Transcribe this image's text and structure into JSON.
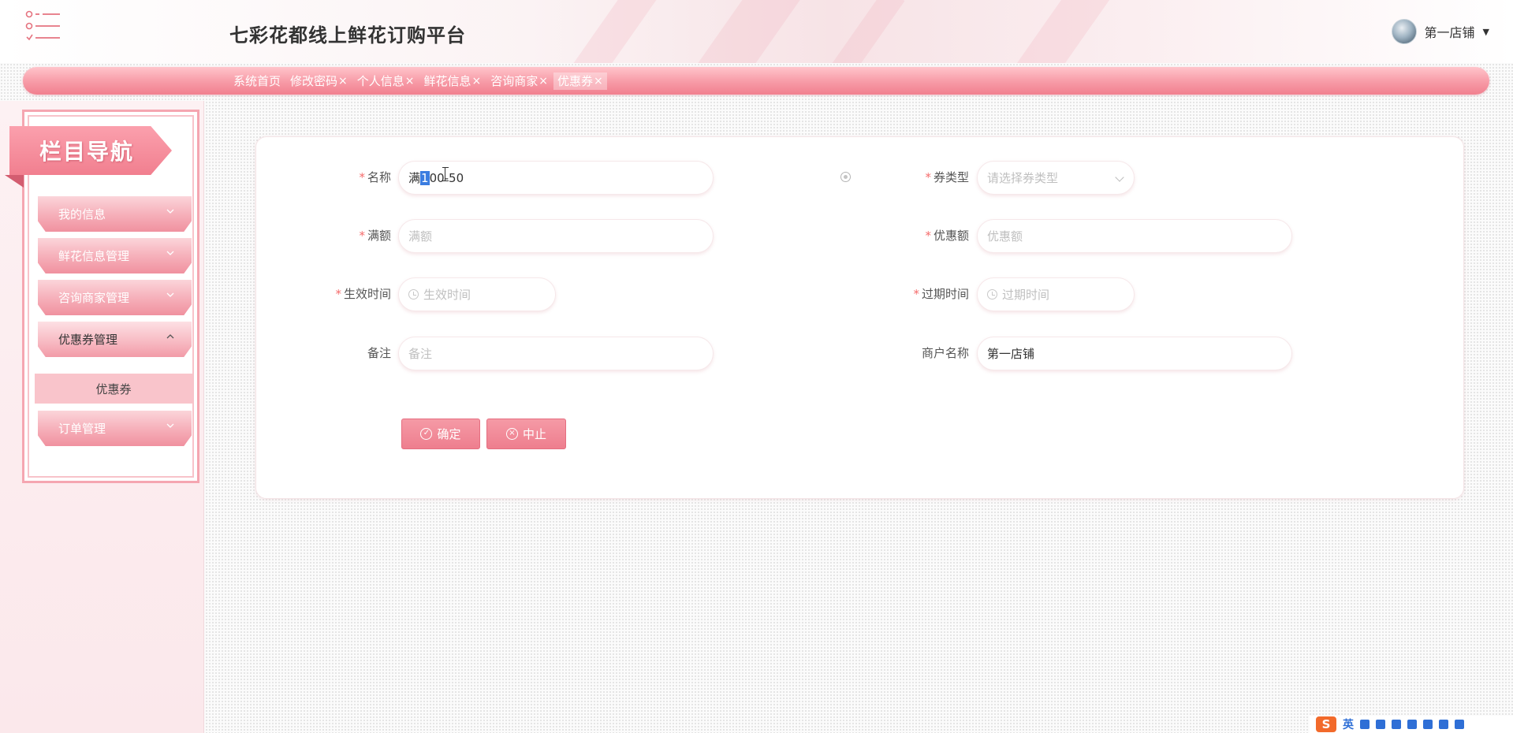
{
  "header": {
    "title": "七彩花都线上鲜花订购平台",
    "user_name": "第一店铺",
    "caret": "▼"
  },
  "tabs": [
    {
      "label": "系统首页",
      "closable": false,
      "active": false
    },
    {
      "label": "修改密码",
      "closable": true,
      "active": false
    },
    {
      "label": "个人信息",
      "closable": true,
      "active": false
    },
    {
      "label": "鲜花信息",
      "closable": true,
      "active": false
    },
    {
      "label": "咨询商家",
      "closable": true,
      "active": false
    },
    {
      "label": "优惠券",
      "closable": true,
      "active": true
    }
  ],
  "tab_close": "×",
  "sidebar": {
    "banner": "栏目导航",
    "items": [
      {
        "label": "我的信息"
      },
      {
        "label": "鲜花信息管理"
      },
      {
        "label": "咨询商家管理"
      },
      {
        "label": "优惠券管理"
      },
      {
        "label": "订单管理"
      }
    ],
    "submenu": {
      "label": "优惠券"
    }
  },
  "form": {
    "required_mark": "*",
    "name": {
      "label": "名称",
      "value_prefix": "满",
      "value_selected": "1",
      "value_suffix": "00-50"
    },
    "coupon_type": {
      "label": "券类型",
      "placeholder": "请选择券类型"
    },
    "full_amount": {
      "label": "满额",
      "placeholder": "满额"
    },
    "discount": {
      "label": "优惠额",
      "placeholder": "优惠额"
    },
    "start_time": {
      "label": "生效时间",
      "placeholder": "生效时间"
    },
    "end_time": {
      "label": "过期时间",
      "placeholder": "过期时间"
    },
    "remark": {
      "label": "备注",
      "placeholder": "备注"
    },
    "merchant": {
      "label": "商户名称",
      "value": "第一店铺"
    },
    "confirm_label": "确定",
    "cancel_label": "中止"
  },
  "ime": {
    "logo": "S",
    "mode": "英"
  },
  "colors": {
    "accent": "#f17f8f",
    "required": "#f56c6c",
    "selection": "#3b7de0"
  }
}
